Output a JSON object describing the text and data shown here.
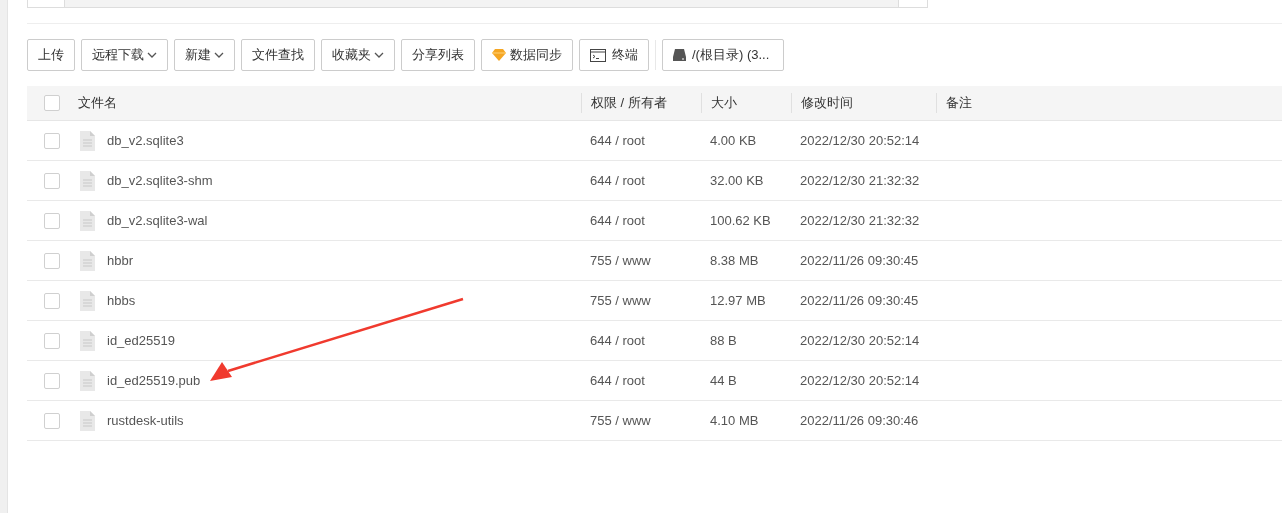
{
  "toolbar": [
    {
      "label": "上传",
      "kind": "plain"
    },
    {
      "label": "远程下载",
      "kind": "dropdown"
    },
    {
      "label": "新建",
      "kind": "dropdown"
    },
    {
      "label": "文件查找",
      "kind": "plain"
    },
    {
      "label": "收藏夹",
      "kind": "dropdown"
    },
    {
      "label": "分享列表",
      "kind": "plain"
    },
    {
      "label": "数据同步",
      "kind": "sync"
    },
    {
      "label": "终端",
      "kind": "terminal"
    },
    {
      "label": "/(根目录) (3...",
      "kind": "disk"
    }
  ],
  "table": {
    "select_all": false,
    "columns": [
      "文件名",
      "权限 / 所有者",
      "大小",
      "修改时间",
      "备注"
    ],
    "rows": [
      {
        "name": "db_v2.sqlite3",
        "perm": "644 / root",
        "size": "4.00 KB",
        "modified": "2022/12/30 20:52:14",
        "checked": false
      },
      {
        "name": "db_v2.sqlite3-shm",
        "perm": "644 / root",
        "size": "32.00 KB",
        "modified": "2022/12/30 21:32:32",
        "checked": false
      },
      {
        "name": "db_v2.sqlite3-wal",
        "perm": "644 / root",
        "size": "100.62 KB",
        "modified": "2022/12/30 21:32:32",
        "checked": false
      },
      {
        "name": "hbbr",
        "perm": "755 / www",
        "size": "8.38 MB",
        "modified": "2022/11/26 09:30:45",
        "checked": false
      },
      {
        "name": "hbbs",
        "perm": "755 / www",
        "size": "12.97 MB",
        "modified": "2022/11/26 09:30:45",
        "checked": false
      },
      {
        "name": "id_ed25519",
        "perm": "644 / root",
        "size": "88 B",
        "modified": "2022/12/30 20:52:14",
        "checked": false
      },
      {
        "name": "id_ed25519.pub",
        "perm": "644 / root",
        "size": "44 B",
        "modified": "2022/12/30 20:52:14",
        "checked": false
      },
      {
        "name": "rustdesk-utils",
        "perm": "755 / www",
        "size": "4.10 MB",
        "modified": "2022/11/26 09:30:46",
        "checked": false
      }
    ]
  }
}
